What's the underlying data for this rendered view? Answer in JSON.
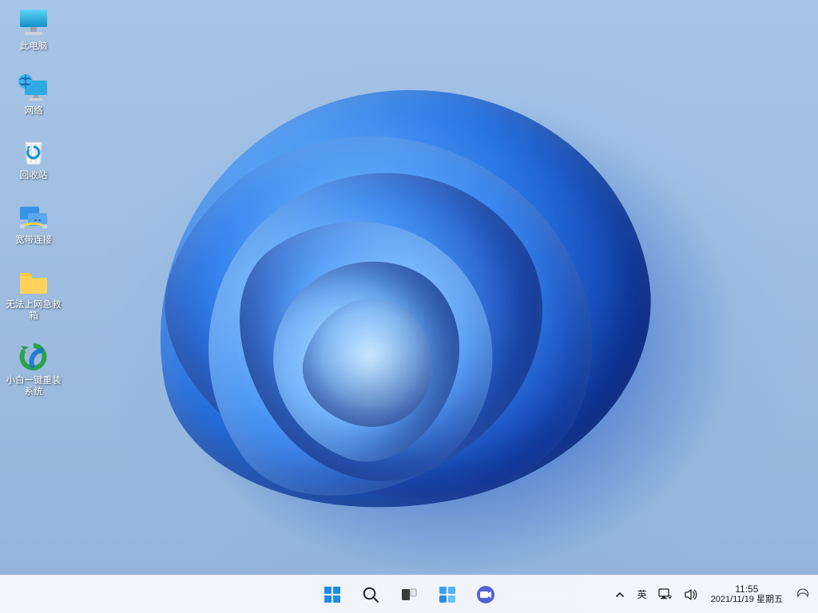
{
  "desktop": {
    "icons": [
      {
        "id": "this-pc",
        "label": "此电脑"
      },
      {
        "id": "network",
        "label": "网络"
      },
      {
        "id": "recycle-bin",
        "label": "回收站"
      },
      {
        "id": "broadband",
        "label": "宽带连接"
      },
      {
        "id": "netfix-box",
        "label": "无法上网急救箱"
      },
      {
        "id": "reinstall",
        "label": "小白一键重装系统"
      }
    ]
  },
  "taskbar": {
    "buttons": {
      "start": "start-icon",
      "search": "search-icon",
      "taskview": "task-view-icon",
      "widgets": "widgets-icon",
      "chat": "chat-icon"
    }
  },
  "systray": {
    "overflow": "chevron-up-icon",
    "ime_label": "英",
    "network": "network-icon",
    "volume": "volume-icon",
    "clock": {
      "time": "11:55",
      "date": "2021/11/19",
      "weekday": "星期五"
    },
    "notifications": "notification-icon"
  }
}
